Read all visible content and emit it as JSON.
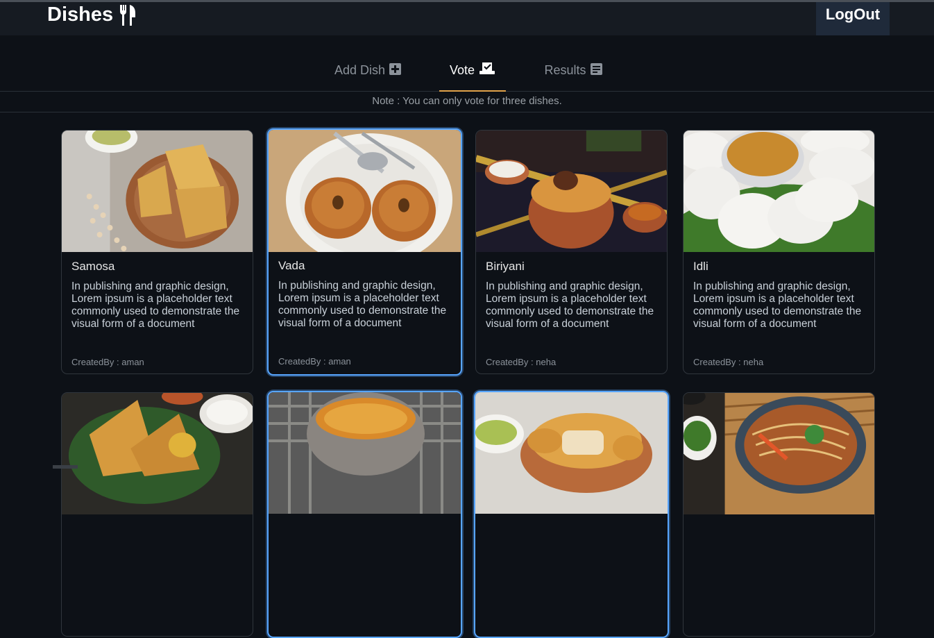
{
  "app": {
    "title": "Dishes",
    "logout_label": "LogOut"
  },
  "tabs": [
    {
      "label": "Add Dish",
      "icon": "plus-square-icon",
      "active": false
    },
    {
      "label": "Vote",
      "icon": "vote-icon",
      "active": true
    },
    {
      "label": "Results",
      "icon": "results-icon",
      "active": false
    }
  ],
  "note": "Note : You can only vote for three dishes.",
  "dishes": [
    {
      "name": "Samosa",
      "description": "In publishing and graphic design, Lorem ipsum is a placeholder text commonly used to demonstrate the visual form of a document",
      "created_by": "CreatedBy : aman",
      "selected": false
    },
    {
      "name": "Vada",
      "description": "In publishing and graphic design, Lorem ipsum is a placeholder text commonly used to demonstrate the visual form of a document",
      "created_by": "CreatedBy : aman",
      "selected": true
    },
    {
      "name": "Biriyani",
      "description": "In publishing and graphic design, Lorem ipsum is a placeholder text commonly used to demonstrate the visual form of a document",
      "created_by": "CreatedBy : neha",
      "selected": false
    },
    {
      "name": "Idli",
      "description": "In publishing and graphic design, Lorem ipsum is a placeholder text commonly used to demonstrate the visual form of a document",
      "created_by": "CreatedBy : neha",
      "selected": false
    },
    {
      "name": "",
      "description": "",
      "created_by": "",
      "selected": false
    },
    {
      "name": "",
      "description": "",
      "created_by": "",
      "selected": true
    },
    {
      "name": "",
      "description": "",
      "created_by": "",
      "selected": true
    },
    {
      "name": "",
      "description": "",
      "created_by": "",
      "selected": false
    }
  ],
  "colors": {
    "accent": "#e0a24a",
    "selected_border": "#58a6ff",
    "navbar": "#161b22",
    "background": "#0d1117"
  }
}
